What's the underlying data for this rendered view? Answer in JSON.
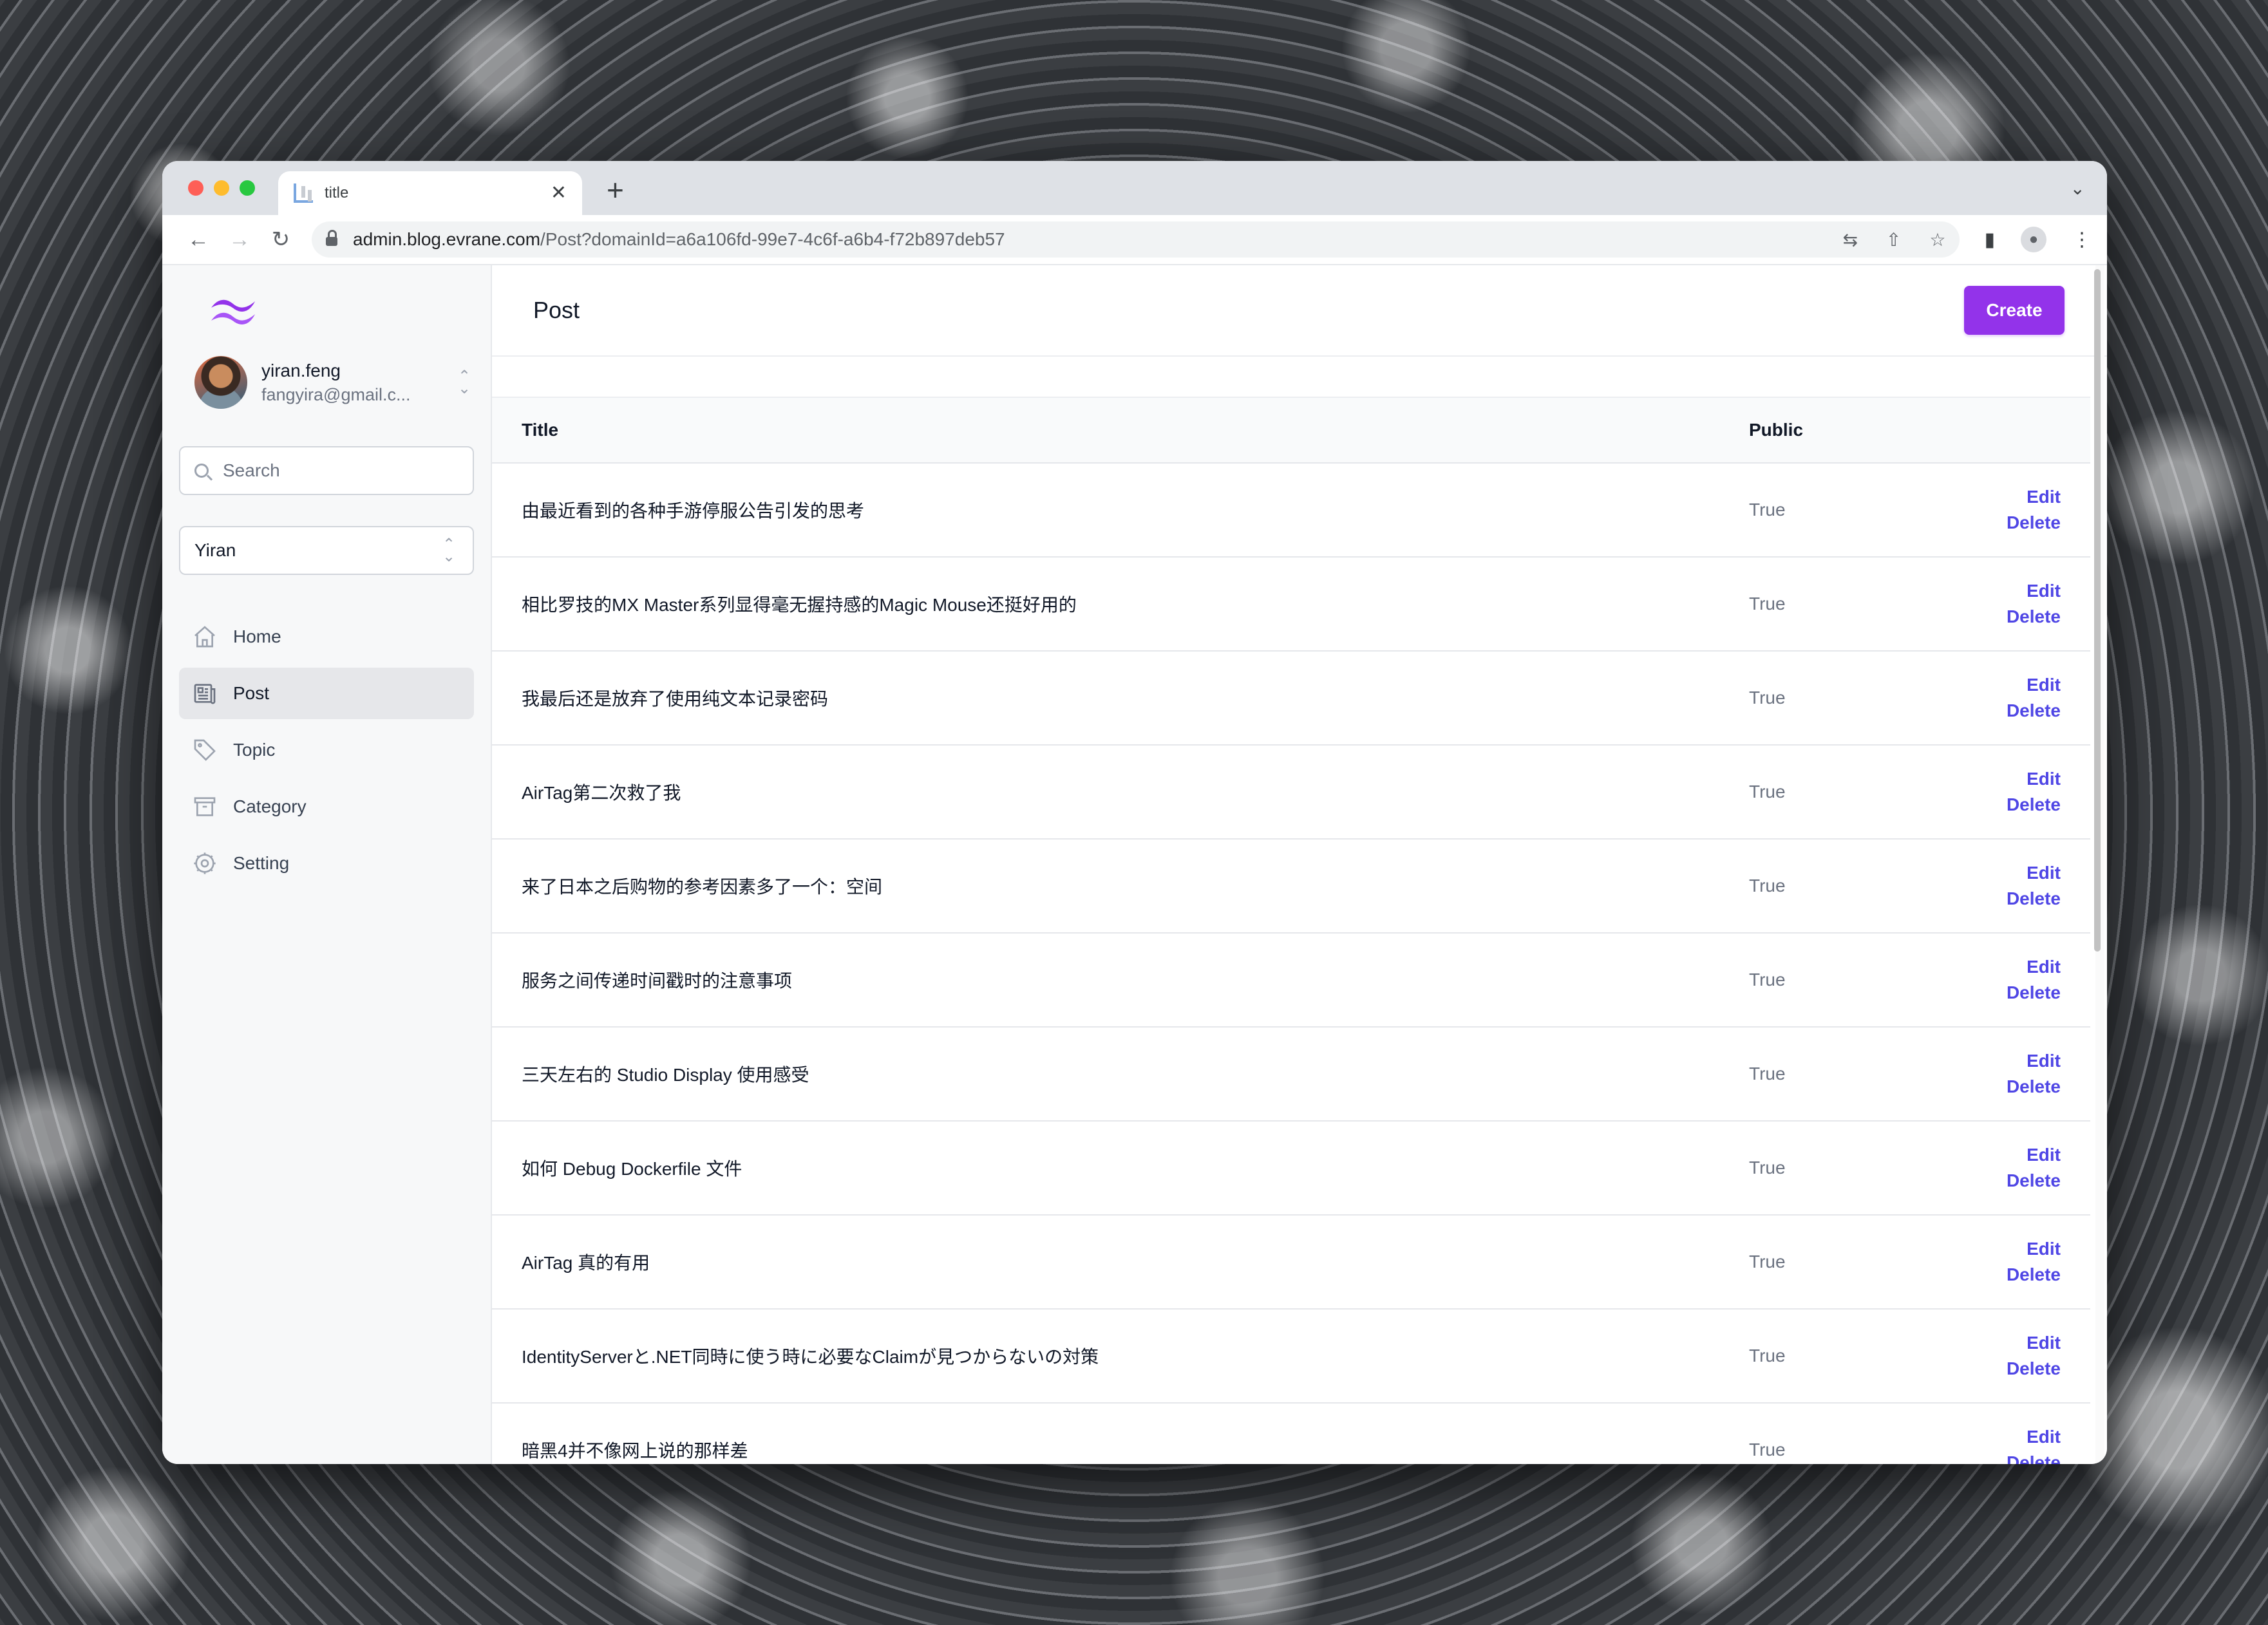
{
  "browser": {
    "tab_title": "title",
    "url_host": "admin.blog.evrane.com",
    "url_path": "/Post?domainId=a6a106fd-99e7-4c6f-a6b4-f72b897deb57"
  },
  "sidebar": {
    "user_name": "yiran.feng",
    "user_email": "fangyira@gmail.c...",
    "search_placeholder": "Search",
    "domain_select_value": "Yiran",
    "nav": [
      {
        "label": "Home",
        "icon": "home-icon"
      },
      {
        "label": "Post",
        "icon": "newspaper-icon"
      },
      {
        "label": "Topic",
        "icon": "tag-icon"
      },
      {
        "label": "Category",
        "icon": "archive-icon"
      },
      {
        "label": "Setting",
        "icon": "gear-icon"
      }
    ],
    "active_nav": "Post"
  },
  "main": {
    "page_title": "Post",
    "create_label": "Create",
    "columns": {
      "title": "Title",
      "public": "Public"
    },
    "edit_label": "Edit",
    "delete_label": "Delete",
    "rows": [
      {
        "title": "由最近看到的各种手游停服公告引发的思考",
        "public": "True"
      },
      {
        "title": "相比罗技的MX Master系列显得毫无握持感的Magic Mouse还挺好用的",
        "public": "True"
      },
      {
        "title": "我最后还是放弃了使用纯文本记录密码",
        "public": "True"
      },
      {
        "title": "AirTag第二次救了我",
        "public": "True"
      },
      {
        "title": "来了日本之后购物的参考因素多了一个：空间",
        "public": "True"
      },
      {
        "title": "服务之间传递时间戳时的注意事项",
        "public": "True"
      },
      {
        "title": "三天左右的 Studio Display 使用感受",
        "public": "True"
      },
      {
        "title": "如何 Debug Dockerfile 文件",
        "public": "True"
      },
      {
        "title": "AirTag 真的有用",
        "public": "True"
      },
      {
        "title": "IdentityServerと.NET同時に使う時に必要なClaimが見つからないの対策",
        "public": "True"
      },
      {
        "title": "暗黑4并不像网上说的那样差",
        "public": "True"
      }
    ]
  },
  "colors": {
    "accent": "#9333ea",
    "link": "#4f46e5"
  }
}
